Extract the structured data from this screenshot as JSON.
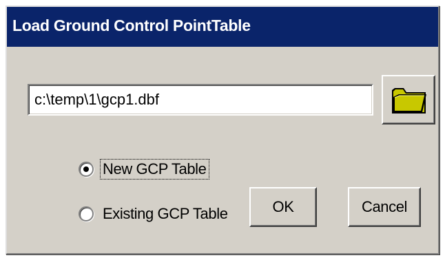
{
  "window": {
    "title": "Load Ground Control PointTable"
  },
  "file_path": {
    "value": "c:\\temp\\1\\gcp1.dbf"
  },
  "browse_button": {
    "icon": "folder-icon"
  },
  "options": [
    {
      "label": "New GCP Table",
      "selected": true
    },
    {
      "label": "Existing GCP Table",
      "selected": false
    }
  ],
  "buttons": {
    "ok_label": "OK",
    "cancel_label": "Cancel"
  },
  "colors": {
    "titlebar": "#0a246a",
    "dialog_face": "#d4d0c8",
    "folder_fill": "#c8c800"
  }
}
